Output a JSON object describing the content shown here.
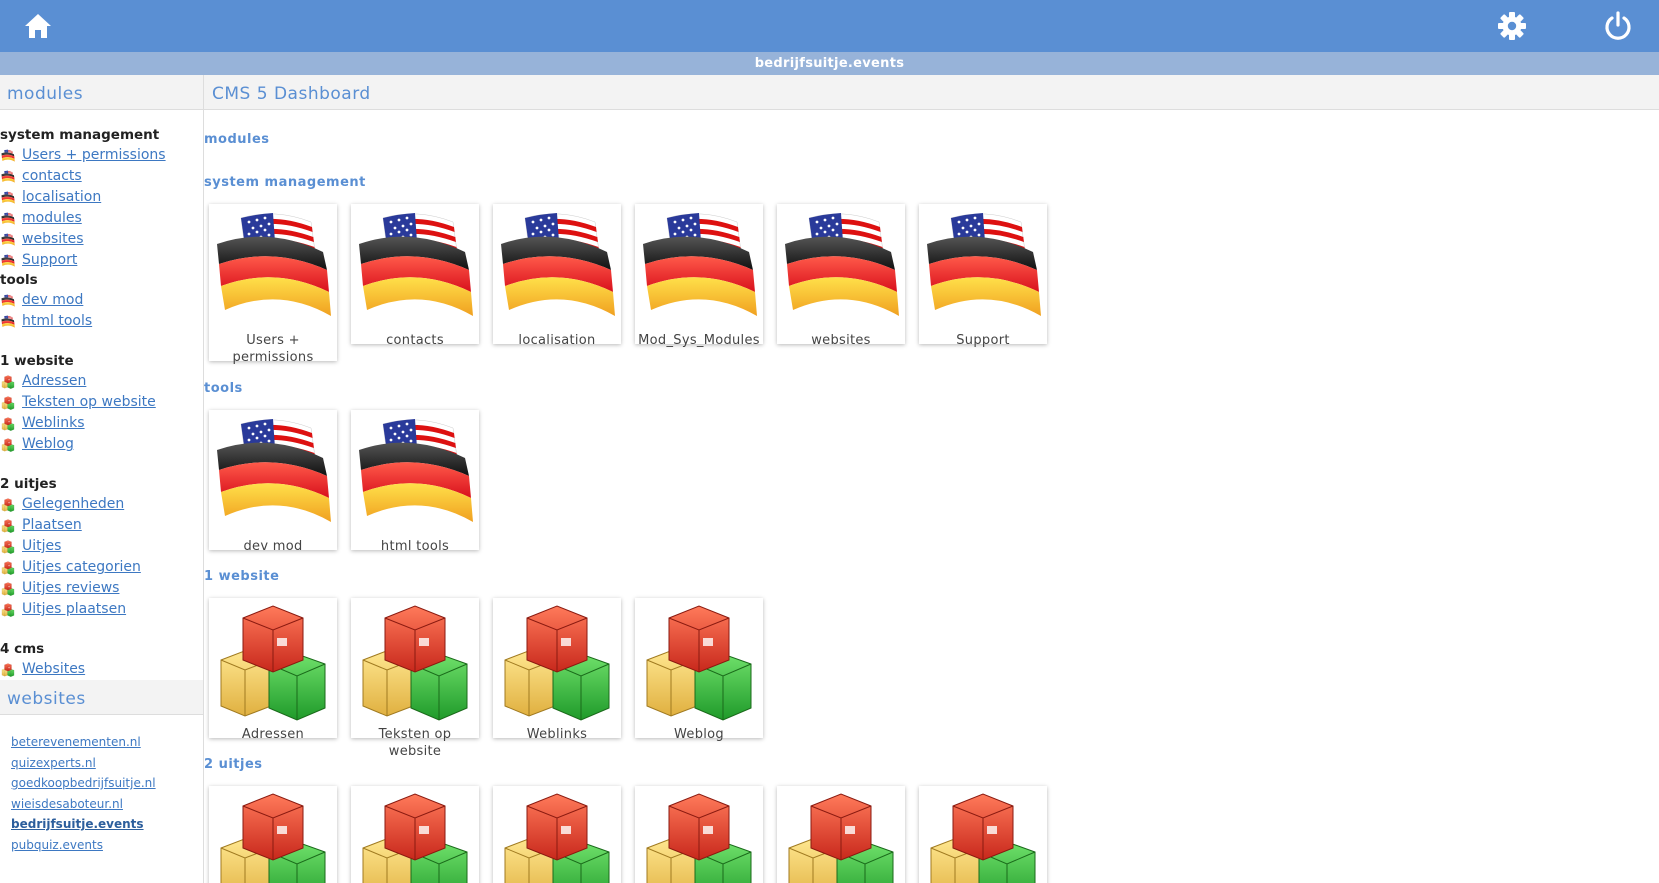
{
  "site_name": "bedrijfsuitje.events",
  "sidebar": {
    "modules_title": "modules",
    "groups": [
      {
        "title": "system management",
        "icon": "flag-icon",
        "items": [
          "Users + permissions",
          "contacts",
          "localisation",
          "modules",
          "websites",
          "Support"
        ]
      },
      {
        "title": "tools",
        "icon": "flag-icon",
        "items": [
          "dev mod",
          "html tools"
        ]
      },
      {
        "title": "1 website",
        "icon": "boxes-icon",
        "items": [
          "Adressen",
          "Teksten op website",
          "Weblinks",
          "Weblog"
        ]
      },
      {
        "title": "2 uitjes",
        "icon": "boxes-icon",
        "items": [
          "Gelegenheden",
          "Plaatsen",
          "Uitjes",
          "Uitjes categorien",
          "Uitjes reviews",
          "Uitjes plaatsen"
        ]
      },
      {
        "title": "4 cms",
        "icon": "boxes-icon",
        "items": [
          "Websites"
        ]
      }
    ],
    "websites_title": "websites",
    "websites": [
      "beterevenementen.nl",
      "quizexperts.nl",
      "goedkoopbedrijfsuitje.nl",
      "wieisdesaboteur.nl",
      "bedrijfsuitje.events",
      "pubquiz.events"
    ],
    "current_website": "bedrijfsuitje.events"
  },
  "main": {
    "title": "CMS 5 Dashboard",
    "modules_heading": "modules",
    "sections": [
      {
        "title": "system management",
        "icon": "flag-icon",
        "tiles": [
          "Users + permissions",
          "contacts",
          "localisation",
          "Mod_Sys_Modules",
          "websites",
          "Support"
        ]
      },
      {
        "title": "tools",
        "icon": "flag-icon",
        "tiles": [
          "dev mod",
          "html tools"
        ]
      },
      {
        "title": "1 website",
        "icon": "boxes-icon",
        "tiles": [
          "Adressen",
          "Teksten op website",
          "Weblinks",
          "Weblog"
        ]
      },
      {
        "title": "2 uitjes",
        "icon": "boxes-icon",
        "tiles": [
          "",
          "",
          "",
          "",
          "",
          ""
        ]
      }
    ]
  },
  "icons": {
    "home": "home-icon",
    "settings": "gear-icon",
    "logout": "power-icon"
  },
  "colors": {
    "accent": "#5a8fd3",
    "subbar": "#97b3d9",
    "link": "#3d78c2"
  }
}
